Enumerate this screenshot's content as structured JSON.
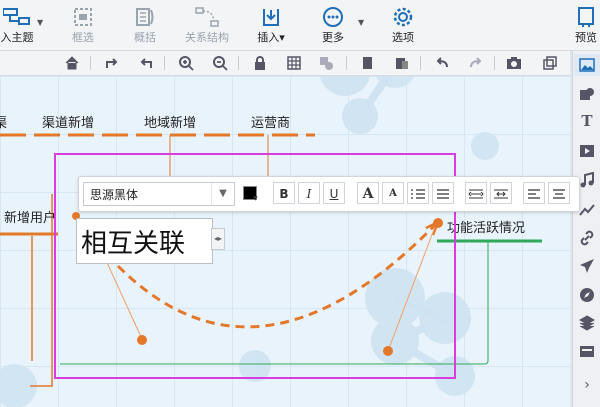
{
  "toolbar": {
    "insert_topic": "入主题",
    "frame_select": "框选",
    "summary": "概括",
    "relation_structure": "关系结构",
    "insert": "插入",
    "more": "更多",
    "options": "选项",
    "preview": "预览"
  },
  "canvas": {
    "nodes": {
      "partial_left": "渠",
      "channel_new": "渠道新增",
      "region_new": "地域新增",
      "operator": "运营商",
      "new_users": "新增用户",
      "feature_active": "功能活跃情况"
    },
    "edit_text": "相互关联"
  },
  "format_bar": {
    "font_name": "思源黑体",
    "bold": "B",
    "italic": "I",
    "underline": "U",
    "grow_font": "A",
    "shrink_font": "A"
  },
  "colors": {
    "accent": "#e4782a",
    "selection": "#d93de0",
    "green_line": "#2eaa5a",
    "toolbar_blue": "#1e6fb8"
  }
}
